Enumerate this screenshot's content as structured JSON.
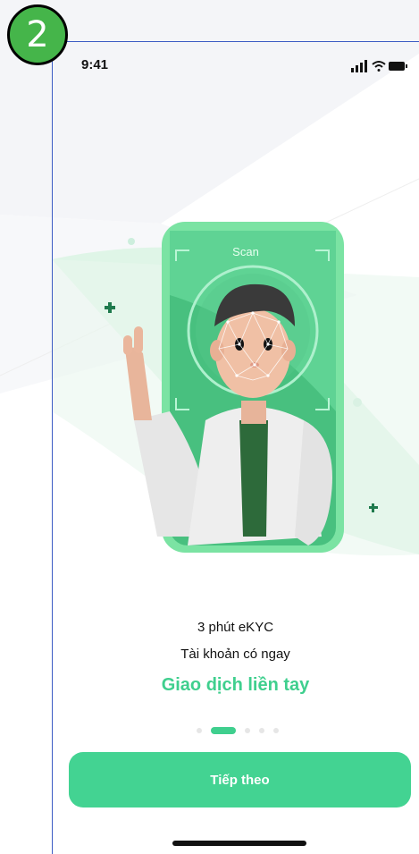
{
  "step_badge": "2",
  "status_bar": {
    "time": "9:41",
    "icons": [
      "signal-icon",
      "wifi-icon",
      "battery-icon"
    ]
  },
  "illustration": {
    "scan_label": "Scan"
  },
  "onboarding": {
    "line1": "3 phút eKYC",
    "line2": "Tài khoản có ngay",
    "highlight": "Giao dịch liền tay",
    "page_count": 5,
    "active_page": 2
  },
  "next_button": {
    "label": "Tiếp theo"
  },
  "colors": {
    "accent": "#3fcf8e",
    "button": "#43d392",
    "badge": "#45b54a",
    "frame_line": "#3c5cc4"
  }
}
